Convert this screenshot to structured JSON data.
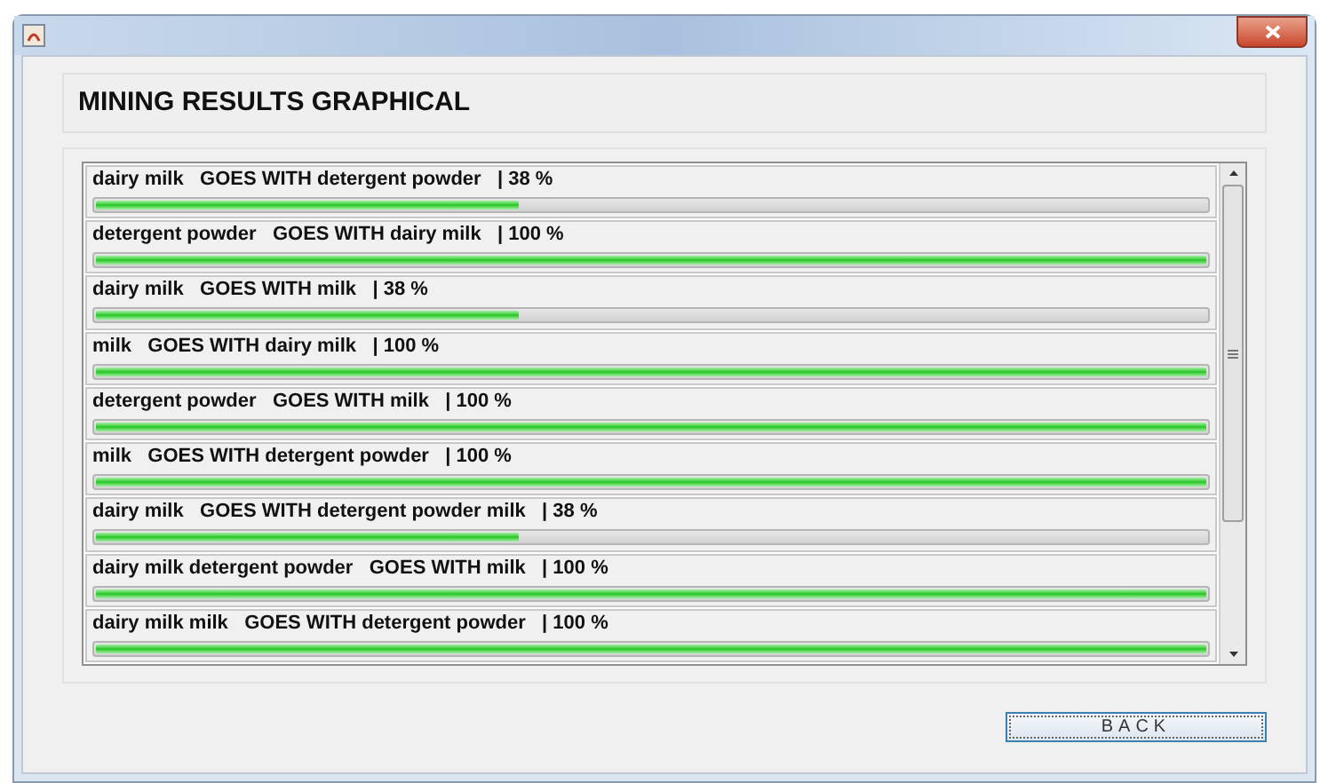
{
  "heading": "MINING RESULTS GRAPHICAL",
  "results": [
    {
      "label": "dairy milk   GOES WITH detergent powder   | 38 %",
      "level": 0.38
    },
    {
      "label": "detergent powder   GOES WITH dairy milk   | 100 %",
      "level": 1
    },
    {
      "label": "dairy milk   GOES WITH milk   | 38 %",
      "level": 0.38
    },
    {
      "label": "milk   GOES WITH dairy milk   | 100 %",
      "level": 1
    },
    {
      "label": "detergent powder   GOES WITH milk   | 100 %",
      "level": 1
    },
    {
      "label": "milk   GOES WITH detergent powder   | 100 %",
      "level": 1
    },
    {
      "label": "dairy milk   GOES WITH detergent powder milk   | 38 %",
      "level": 0.38
    },
    {
      "label": "dairy milk detergent powder   GOES WITH milk   | 100 %",
      "level": 1
    },
    {
      "label": "dairy milk milk   GOES WITH detergent powder   | 100 %",
      "level": 1
    }
  ],
  "buttons": [
    {
      "label": "BACK"
    }
  ]
}
